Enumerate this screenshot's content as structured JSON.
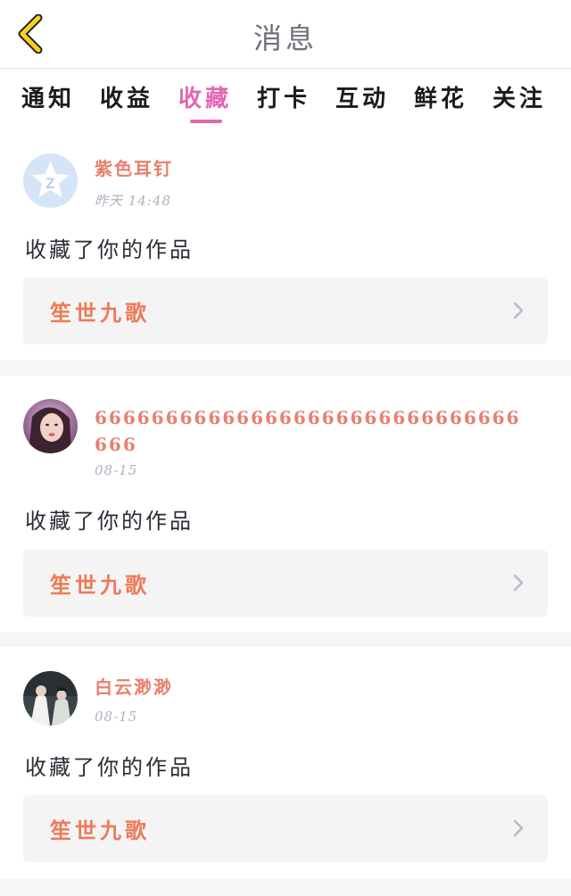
{
  "header": {
    "title": "消息"
  },
  "tabs": [
    {
      "label": "通知"
    },
    {
      "label": "收益"
    },
    {
      "label": "收藏"
    },
    {
      "label": "打卡"
    },
    {
      "label": "互动"
    },
    {
      "label": "鲜花"
    },
    {
      "label": "关注"
    }
  ],
  "active_tab": "收藏",
  "colors": {
    "accent_pink": "#e466b0",
    "username_color": "#e8806d",
    "work_title_color": "#ee7a57",
    "back_icon_yellow": "#f7d11c"
  },
  "items": [
    {
      "username": "紫色耳钉",
      "time": "昨天 14:48",
      "action": "收藏了你的作品",
      "work_title": "笙世九歌",
      "avatar_icon": "default-star-avatar-icon"
    },
    {
      "username_line1": "666666666666666666666666666666",
      "username_line2": "666",
      "time": "08-15",
      "action": "收藏了你的作品",
      "work_title": "笙世九歌",
      "avatar_icon": "user-photo-avatar"
    },
    {
      "username": "白云渺渺",
      "time": "08-15",
      "action": "收藏了你的作品",
      "work_title": "笙世九歌",
      "avatar_icon": "user-photo-avatar"
    }
  ]
}
